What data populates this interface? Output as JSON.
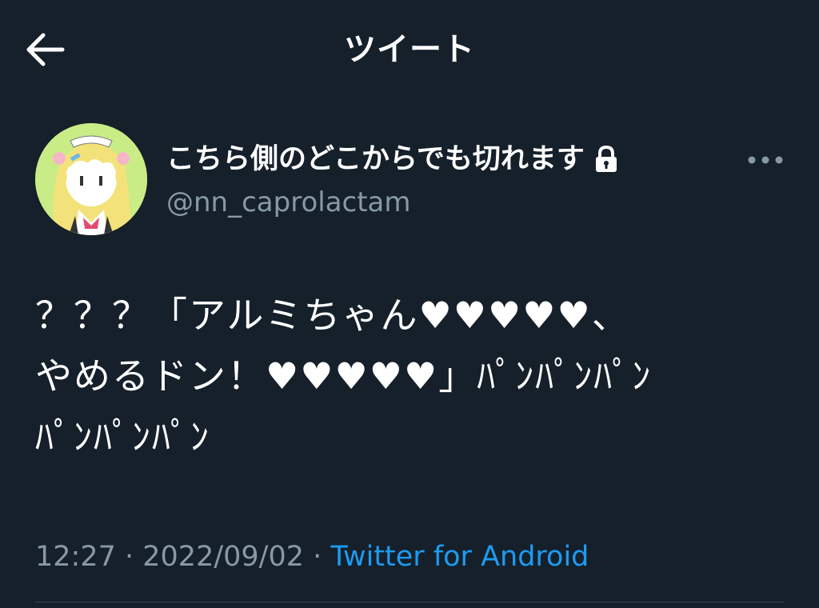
{
  "header": {
    "title": "ツイート"
  },
  "author": {
    "display_name": "こちら側のどこからでも切れます",
    "handle": "@nn_caprolactam",
    "verified_lock_icon": "lock-icon"
  },
  "tweet": {
    "text": "？？？「アルミちゃん♥♥♥♥♥、\nやめるドン！♥♥♥♥♥」ﾊﾟﾝﾊﾟﾝﾊﾟﾝ\nﾊﾟﾝﾊﾟﾝﾊﾟﾝ"
  },
  "meta": {
    "time": "12:27",
    "separator": " · ",
    "date": "2022/09/02",
    "source": "Twitter for Android"
  },
  "colors": {
    "background": "#15202b",
    "text": "#ffffff",
    "muted": "#8899a6",
    "link": "#1d9bf0",
    "divider": "#38444d"
  },
  "icons": [
    "back-arrow-icon",
    "lock-icon",
    "more-icon"
  ]
}
